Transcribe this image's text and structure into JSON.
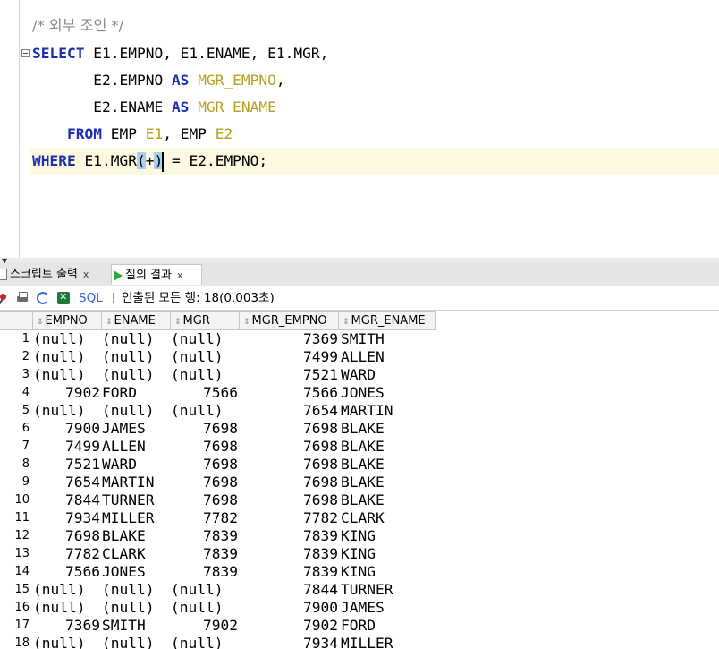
{
  "editor": {
    "comment": "/* 외부 조인 */",
    "lines": [
      {
        "parts": [
          {
            "t": "SELECT",
            "c": "kw"
          },
          {
            "t": " E1.EMPNO, E1.ENAME, E1.MGR,",
            "c": ""
          }
        ]
      },
      {
        "parts": [
          {
            "t": "       E2.EMPNO ",
            "c": ""
          },
          {
            "t": "AS",
            "c": "kw"
          },
          {
            "t": " ",
            "c": ""
          },
          {
            "t": "MGR_EMPNO",
            "c": "al"
          },
          {
            "t": ",",
            "c": ""
          }
        ]
      },
      {
        "parts": [
          {
            "t": "       E2.ENAME ",
            "c": ""
          },
          {
            "t": "AS",
            "c": "kw"
          },
          {
            "t": " ",
            "c": ""
          },
          {
            "t": "MGR_ENAME",
            "c": "al"
          }
        ]
      },
      {
        "parts": [
          {
            "t": "    ",
            "c": ""
          },
          {
            "t": "FROM",
            "c": "kw"
          },
          {
            "t": " EMP ",
            "c": ""
          },
          {
            "t": "E1",
            "c": "al"
          },
          {
            "t": ", EMP ",
            "c": ""
          },
          {
            "t": "E2",
            "c": "al"
          }
        ]
      },
      {
        "parts": [
          {
            "t": "WHERE",
            "c": "kw"
          },
          {
            "t": " E1.MGR",
            "c": ""
          },
          {
            "t": "(",
            "c": "sel"
          },
          {
            "t": "+",
            "c": ""
          },
          {
            "t": ")",
            "c": "sel"
          },
          {
            "t": "CARET",
            "c": "caret"
          },
          {
            "t": " = E2.EMPNO;",
            "c": ""
          }
        ]
      }
    ]
  },
  "tabs": [
    {
      "label": "스크립트 출력",
      "icon": "script-output-icon"
    },
    {
      "label": "질의 결과",
      "icon": "play-icon"
    }
  ],
  "tab_close": "x",
  "toolbar": {
    "sql_label": "SQL",
    "status": "인출된 모든 행: 18(0.003초)"
  },
  "grid": {
    "columns": [
      "EMPNO",
      "ENAME",
      "MGR",
      "MGR_EMPNO",
      "MGR_ENAME"
    ],
    "rows": [
      [
        "1",
        "(null)",
        "(null)",
        "(null)",
        "7369",
        "SMITH"
      ],
      [
        "2",
        "(null)",
        "(null)",
        "(null)",
        "7499",
        "ALLEN"
      ],
      [
        "3",
        "(null)",
        "(null)",
        "(null)",
        "7521",
        "WARD"
      ],
      [
        "4",
        "7902",
        "FORD",
        "7566",
        "7566",
        "JONES"
      ],
      [
        "5",
        "(null)",
        "(null)",
        "(null)",
        "7654",
        "MARTIN"
      ],
      [
        "6",
        "7900",
        "JAMES",
        "7698",
        "7698",
        "BLAKE"
      ],
      [
        "7",
        "7499",
        "ALLEN",
        "7698",
        "7698",
        "BLAKE"
      ],
      [
        "8",
        "7521",
        "WARD",
        "7698",
        "7698",
        "BLAKE"
      ],
      [
        "9",
        "7654",
        "MARTIN",
        "7698",
        "7698",
        "BLAKE"
      ],
      [
        "10",
        "7844",
        "TURNER",
        "7698",
        "7698",
        "BLAKE"
      ],
      [
        "11",
        "7934",
        "MILLER",
        "7782",
        "7782",
        "CLARK"
      ],
      [
        "12",
        "7698",
        "BLAKE",
        "7839",
        "7839",
        "KING"
      ],
      [
        "13",
        "7782",
        "CLARK",
        "7839",
        "7839",
        "KING"
      ],
      [
        "14",
        "7566",
        "JONES",
        "7839",
        "7839",
        "KING"
      ],
      [
        "15",
        "(null)",
        "(null)",
        "(null)",
        "7844",
        "TURNER"
      ],
      [
        "16",
        "(null)",
        "(null)",
        "(null)",
        "7900",
        "JAMES"
      ],
      [
        "17",
        "7369",
        "SMITH",
        "7902",
        "7902",
        "FORD"
      ],
      [
        "18",
        "(null)",
        "(null)",
        "(null)",
        "7934",
        "MILLER"
      ]
    ]
  }
}
